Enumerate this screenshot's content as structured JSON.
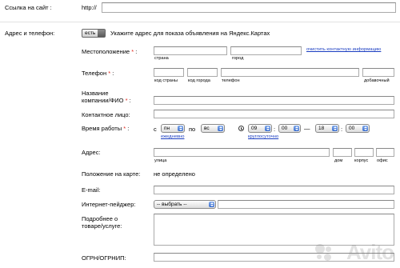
{
  "link_row": {
    "label": "Ссылка на сайт :",
    "prefix": "http://"
  },
  "address_phone": {
    "label": "Адрес и телефон:",
    "toggle_label": "есть",
    "hint": "Укажите адрес для показа объявления на Яндекс.Картах"
  },
  "location": {
    "label": "Местоположение",
    "req": "*",
    "colon": ":",
    "sub_country": "страна",
    "sub_city": "город",
    "clear_link": "очистить контактную информацию"
  },
  "phone": {
    "label": "Телефон",
    "req": "*",
    "colon": ":",
    "sub_country_code": "код страны",
    "sub_city_code": "код города",
    "sub_phone": "телефон",
    "sub_ext": "добавочный"
  },
  "company": {
    "label_line1": "Название",
    "label_line2": "компании/ФИО",
    "req": "*",
    "colon": ":"
  },
  "contact": {
    "label": "Контактное лицо:"
  },
  "work_time": {
    "label": "Время работы",
    "req": "*",
    "colon": ":",
    "from_prefix": "с",
    "day_from": "пн",
    "to_prefix": "по",
    "day_to": "вс",
    "daily_link": "ежедневно",
    "hour_from": "09",
    "min_from": "00",
    "dash": "—",
    "hour_to": "18",
    "min_to": "00",
    "round_clock_link": "круглосуточно",
    "clock_icon": "clock-icon"
  },
  "address": {
    "label": "Адрес:",
    "sub_street": "улица",
    "sub_house": "дом",
    "sub_building": "корпус",
    "sub_office": "офис"
  },
  "map_pos": {
    "label": "Положение на карте:",
    "value": "не определено"
  },
  "email": {
    "label": "E-mail:"
  },
  "messenger": {
    "label": "Интернет-пейджер:",
    "select": "-- выбрать --"
  },
  "details": {
    "label_line1": "Подробнее о",
    "label_line2": "товаре/услуге:"
  },
  "ogrn": {
    "label": "ОГРН/ОГРНИП:"
  },
  "watermark": "Avito"
}
